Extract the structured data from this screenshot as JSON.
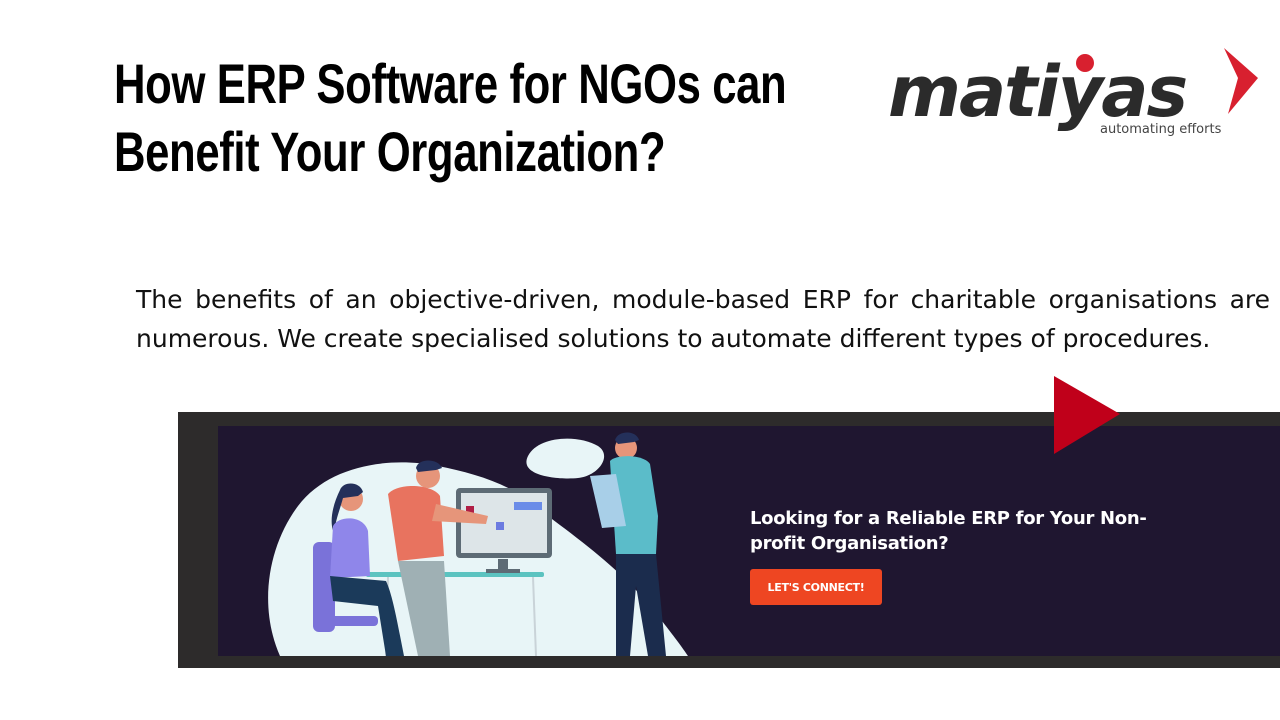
{
  "header": {
    "title_lines": [
      "How ERP Software for NGOs can",
      "Benefit Your Organization?"
    ]
  },
  "logo": {
    "name": "matiyas",
    "tagline": "automating efforts",
    "accent_color": "#d8202f"
  },
  "intro": {
    "text": "The benefits of an objective-driven, module-based ERP for charitable organisations are numerous. We create specialised solutions to automate different types of procedures."
  },
  "banner": {
    "heading": "Looking for a Reliable ERP for Your Non-profit Organisation?",
    "cta_label": "LET'S CONNECT!",
    "cta_color": "#ee4622",
    "background_color": "#1f1630",
    "illustration": "team-working-at-computer-illustration"
  },
  "play_icon": {
    "color": "#c0001a"
  }
}
